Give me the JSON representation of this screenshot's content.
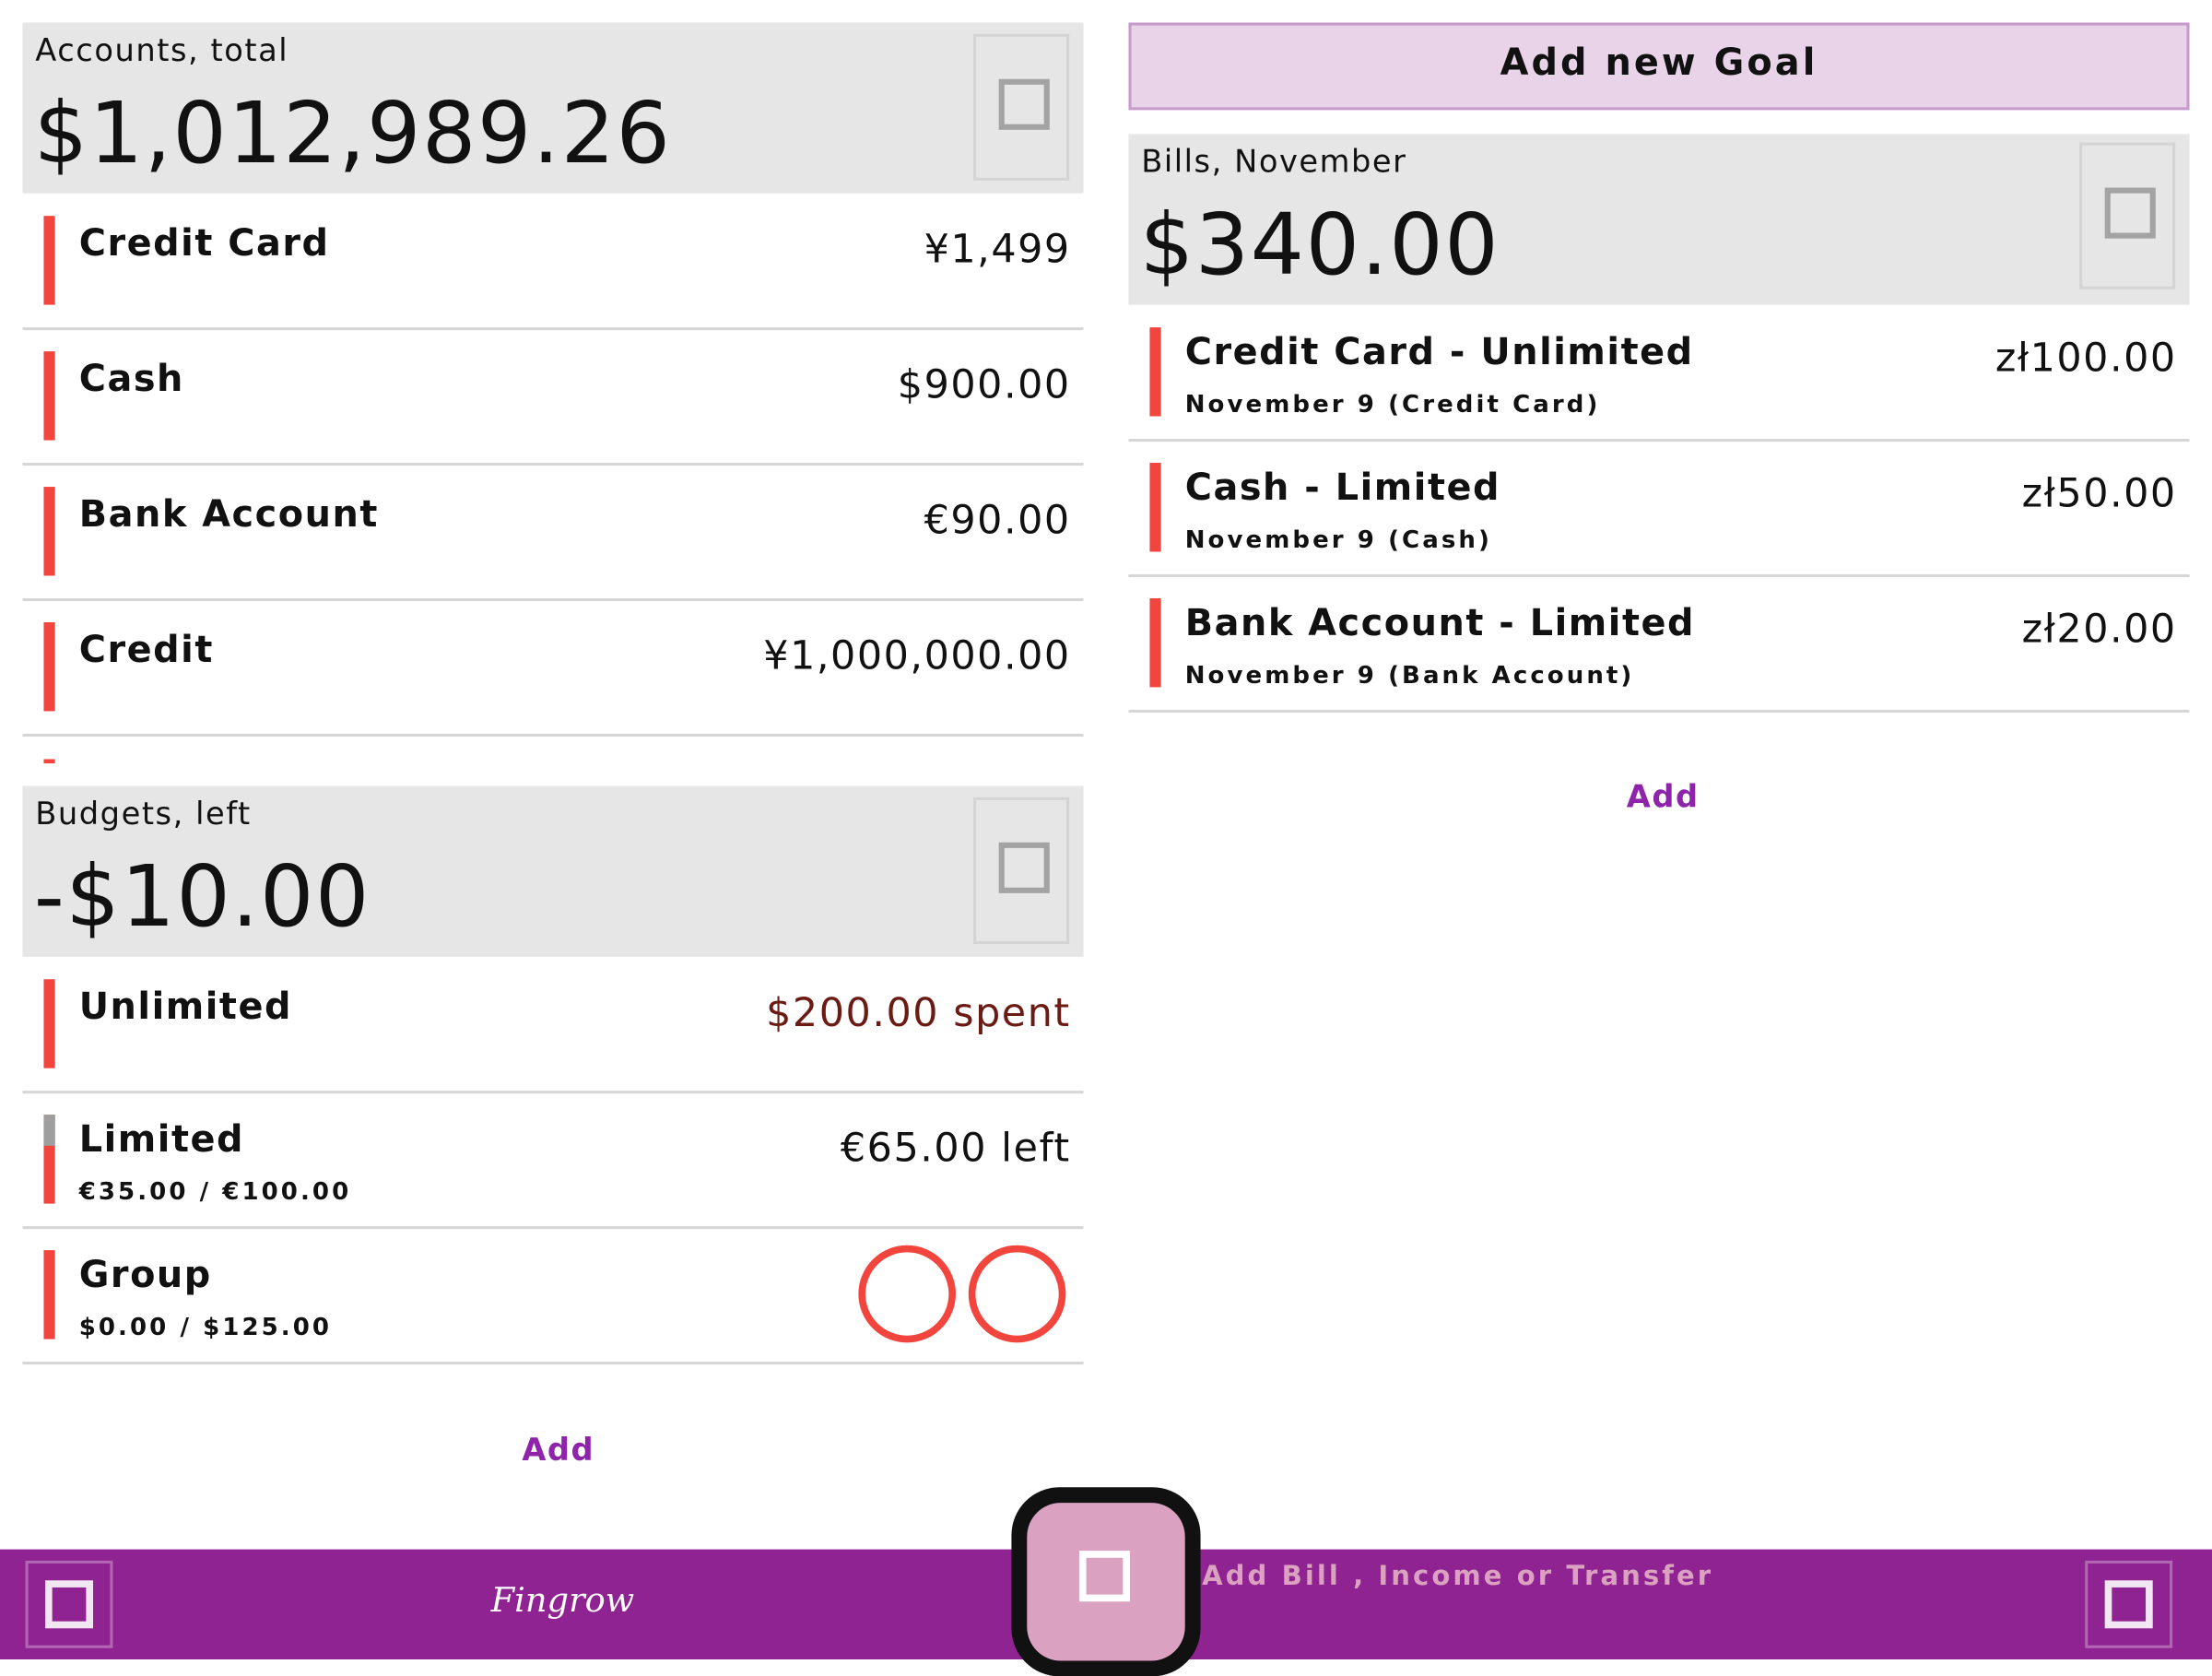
{
  "accounts": {
    "label": "Accounts, total",
    "total": "$1,012,989.26",
    "items": [
      {
        "name": "Credit Card",
        "amount": "¥1,499"
      },
      {
        "name": "Cash",
        "amount": "$900.00"
      },
      {
        "name": "Bank Account",
        "amount": "€90.00"
      },
      {
        "name": "Credit",
        "amount": "¥1,000,000.00"
      }
    ]
  },
  "budgets": {
    "label": "Budgets, left",
    "total": "-$10.00",
    "items": [
      {
        "name": "Unlimited",
        "amount": "$200.00 spent"
      },
      {
        "name": "Limited",
        "sub": "€35.00 / €100.00",
        "amount": "€65.00 left",
        "progress": 0.35
      },
      {
        "name": "Group",
        "sub": "$0.00 / $125.00"
      }
    ],
    "add_label": "Add"
  },
  "goals": {
    "add_label": "Add new Goal"
  },
  "bills": {
    "label": "Bills, November",
    "total": "$340.00",
    "items": [
      {
        "name": "Credit Card - Unlimited",
        "sub": "November 9 (Credit Card)",
        "amount": "zł100.00"
      },
      {
        "name": "Cash - Limited",
        "sub": "November 9 (Cash)",
        "amount": "zł50.00"
      },
      {
        "name": "Bank Account - Limited",
        "sub": "November 9 (Bank Account)",
        "amount": "zł20.00"
      }
    ],
    "add_label": "Add"
  },
  "bottom_bar": {
    "logo": "Fingrow",
    "action_label": "Add Bill , Income or Transfer"
  },
  "colors": {
    "accent": "#8e2391",
    "indicator": "#f2453d",
    "spent": "#6b1a14",
    "add_goal_bg": "#e9d3e9",
    "fab": "#dba1c0"
  }
}
